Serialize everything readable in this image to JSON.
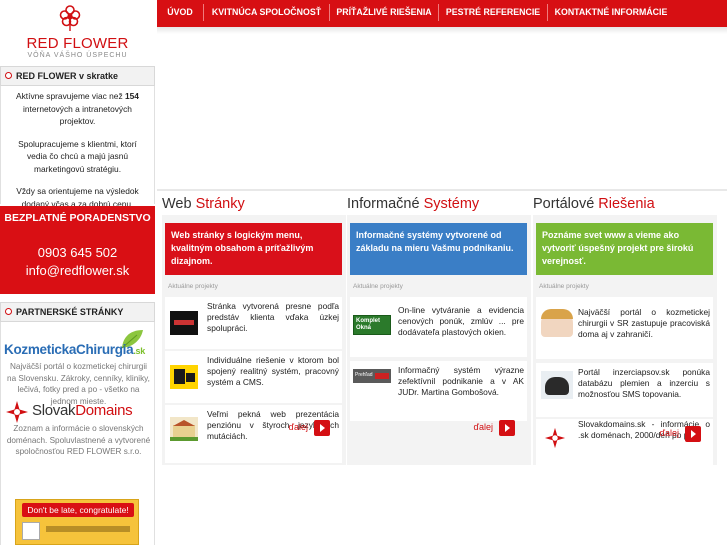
{
  "logo": {
    "brand": "RED FLOWER",
    "slogan": "VÔŇA VÁŠHO ÚSPECHU"
  },
  "about": {
    "title": "RED FLOWER v skratke",
    "p1_a": "Aktívne spravujeme viac než",
    "p1_num": "154",
    "p1_b": "internetových a intranetových projektov.",
    "p2": "Spolupracujeme s klientmi, ktorí vedia čo chcú a majú jasnú marketingovú stratégiu.",
    "p3": "Vždy sa orientujeme na výsledok dodaný včas a za dobrú cenu."
  },
  "consult": {
    "title": "BEZPLATNÉ PORADENSTVO",
    "phone": "0903 645 502",
    "email": "info@redflower.sk"
  },
  "partners": {
    "title": "PARTNERSKÉ STRÁNKY",
    "p1_logo": "KozmetickaChirurgia",
    "p1_logo_tld": ".sk",
    "p1_text": "Najväčší portál o kozmetickej chirurgii na Slovensku. Zákroky, cenníky, kliniky, lečivá, fotky pred a po - všetko na jednom mieste.",
    "p2_logo_a": "Slovak",
    "p2_logo_b": "Domains",
    "p2_text": "Zoznam a informácie o slovenských doménach. Spoluvlastnené a vytvorené spoločnosťou RED FLOWER s.r.o.",
    "banner": "Don't be late, congratulate!"
  },
  "nav": [
    "ÚVOD",
    "KVITNÚCA SPOLOČNOSŤ",
    "PRÍŤAŽLIVÉ RIEŠENIA",
    "PESTRÉ REFERENCIE",
    "KONTAKTNÉ INFORMÁCIE"
  ],
  "columns": [
    {
      "title_a": "Web",
      "title_b": "Stránky",
      "feature": "Web stránky s logickým menu, kvalitným obsahom a príťažlivým dizajnom.",
      "sublabel": "Aktuálne projekty",
      "projects": [
        "Stránka vytvorená presne podľa predstáv klienta vďaka úzkej spolupráci.",
        "Individuálne riešenie v ktorom bol spojený realitný systém, pracovný systém a CMS.",
        "Veľmi pekná web prezentácia penziónu v štyroch jazykových mutáciách."
      ],
      "more": "ďalej"
    },
    {
      "title_a": "Informačné",
      "title_b": "Systémy",
      "feature": "Informačné systémy vytvorené od základu na mieru Vašmu podnikaniu.",
      "sublabel": "Aktuálne projekty",
      "projects": [
        "On-line vytváranie a evidencia cenových ponúk, zmlúv ... pre dodávateľa plastových okien.",
        "Informačný systém výrazne zefektívnil podnikanie a v AK JUDr. Martina Gombošová."
      ],
      "thumb_labels": [
        "Komplet Okná",
        "Prehľad"
      ],
      "more": "ďalej"
    },
    {
      "title_a": "Portálové",
      "title_b": "Riešenia",
      "feature": "Poznáme svet www a vieme ako vytvoriť úspešný projekt pre širokú verejnosť.",
      "sublabel": "Aktuálne projekty",
      "projects": [
        "Najväčší portál o kozmetickej chirurgii v SR zastupuje pracoviská doma aj v zahraničí.",
        "Portál inzerciapsov.sk ponúka databázu plemien a inzerciu s možnosťou SMS topovania.",
        "Slovakdomains.sk - informácie o .sk doménach, 2000/deň po prvo"
      ],
      "more": "ďalej"
    }
  ],
  "colors": {
    "brand_red": "#d70f13",
    "blue": "#3a7ec6",
    "green": "#7ab934"
  }
}
